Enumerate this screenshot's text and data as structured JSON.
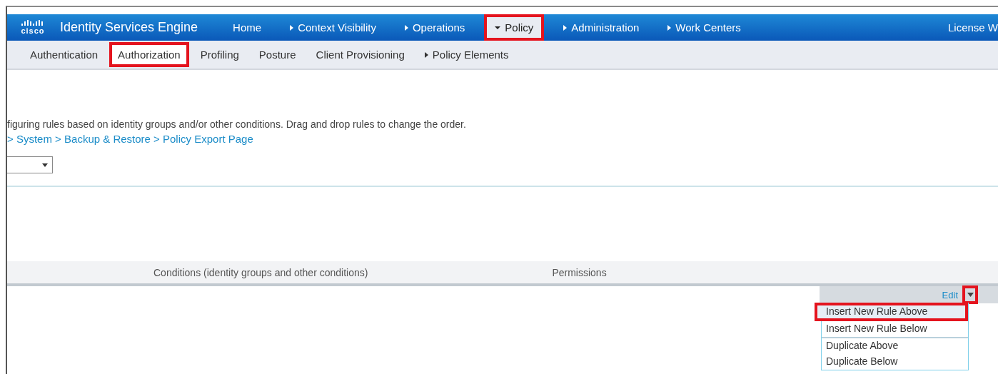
{
  "header": {
    "logo": "cisco",
    "product": "Identity Services Engine",
    "nav": [
      {
        "label": "Home",
        "kind": "link",
        "highlighted": false
      },
      {
        "label": "Context Visibility",
        "kind": "collapsed",
        "highlighted": false
      },
      {
        "label": "Operations",
        "kind": "collapsed",
        "highlighted": false
      },
      {
        "label": "Policy",
        "kind": "expanded",
        "highlighted": true
      },
      {
        "label": "Administration",
        "kind": "collapsed",
        "highlighted": false
      },
      {
        "label": "Work Centers",
        "kind": "collapsed",
        "highlighted": false
      }
    ],
    "license": "License W"
  },
  "subnav": [
    {
      "label": "Authentication",
      "arrow": false,
      "selected": false
    },
    {
      "label": "Authorization",
      "arrow": false,
      "selected": true
    },
    {
      "label": "Profiling",
      "arrow": false,
      "selected": false
    },
    {
      "label": "Posture",
      "arrow": false,
      "selected": false
    },
    {
      "label": "Client Provisioning",
      "arrow": false,
      "selected": false
    },
    {
      "label": "Policy Elements",
      "arrow": true,
      "selected": false
    }
  ],
  "description": "figuring rules based on identity groups and/or other conditions. Drag and drop rules to change the order.",
  "link": "> System > Backup & Restore > Policy Export Page",
  "table": {
    "columns": [
      "Conditions (identity groups and other conditions)",
      "Permissions"
    ],
    "edit": "Edit",
    "caret_highlighted": true
  },
  "menu": [
    {
      "label": "Insert New Rule Above",
      "highlighted": true,
      "divider_after": false
    },
    {
      "label": "Insert New Rule Below",
      "highlighted": false,
      "divider_after": true
    },
    {
      "label": "Duplicate Above",
      "highlighted": false,
      "divider_after": false
    },
    {
      "label": "Duplicate Below",
      "highlighted": false,
      "divider_after": false
    }
  ]
}
